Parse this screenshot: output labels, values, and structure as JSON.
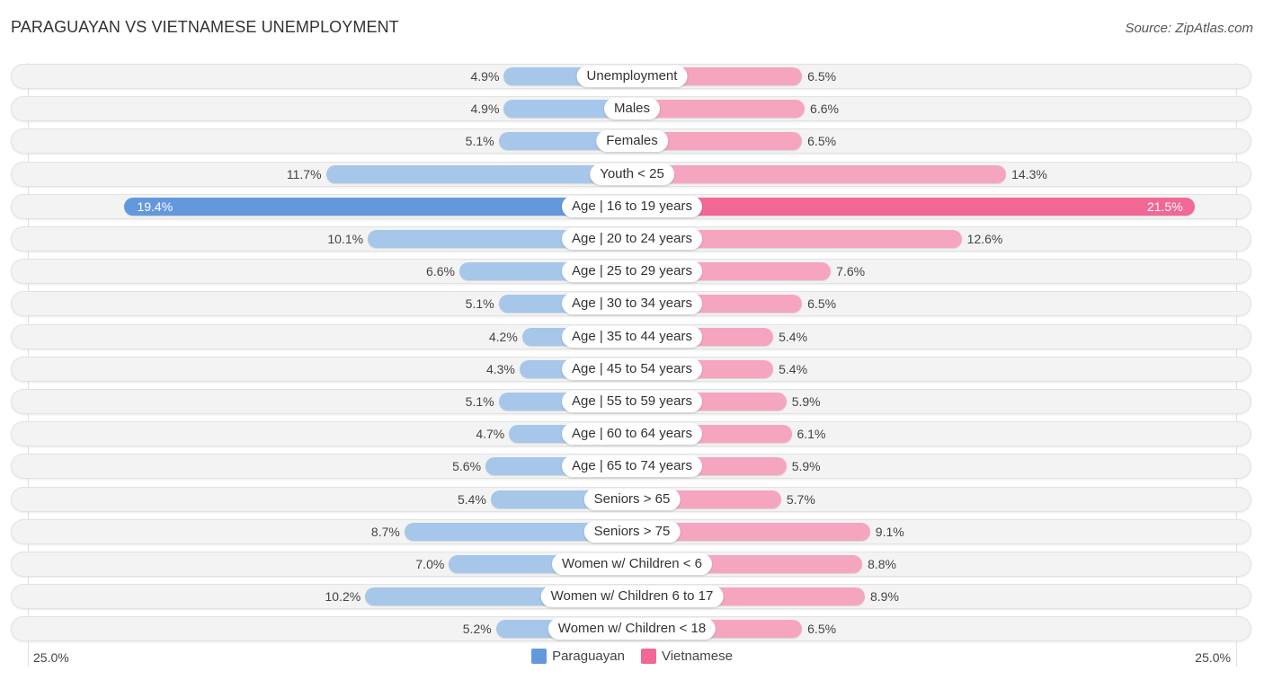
{
  "header": {
    "title": "PARAGUAYAN VS VIETNAMESE UNEMPLOYMENT",
    "source": "Source: ZipAtlas.com"
  },
  "colors": {
    "paraguayan": "#a7c7ea",
    "paraguayan_highlight": "#6399dc",
    "vietnamese": "#f6a5bf",
    "vietnamese_highlight": "#f06893"
  },
  "chart_data": {
    "type": "bar",
    "orientation": "horizontal-diverging",
    "title": "PARAGUAYAN VS VIETNAMESE UNEMPLOYMENT",
    "xlabel": "",
    "ylabel": "",
    "xlim": [
      -25,
      25
    ],
    "axis_labels": {
      "left": "25.0%",
      "right": "25.0%"
    },
    "legend": {
      "position": "bottom-center",
      "entries": [
        "Paraguayan",
        "Vietnamese"
      ]
    },
    "highlight_index": 4,
    "categories": [
      "Unemployment",
      "Males",
      "Females",
      "Youth < 25",
      "Age | 16 to 19 years",
      "Age | 20 to 24 years",
      "Age | 25 to 29 years",
      "Age | 30 to 34 years",
      "Age | 35 to 44 years",
      "Age | 45 to 54 years",
      "Age | 55 to 59 years",
      "Age | 60 to 64 years",
      "Age | 65 to 74 years",
      "Seniors > 65",
      "Seniors > 75",
      "Women w/ Children < 6",
      "Women w/ Children 6 to 17",
      "Women w/ Children < 18"
    ],
    "series": [
      {
        "name": "Paraguayan",
        "values": [
          4.9,
          4.9,
          5.1,
          11.7,
          19.4,
          10.1,
          6.6,
          5.1,
          4.2,
          4.3,
          5.1,
          4.7,
          5.6,
          5.4,
          8.7,
          7.0,
          10.2,
          5.2
        ],
        "labels": [
          "4.9%",
          "4.9%",
          "5.1%",
          "11.7%",
          "19.4%",
          "10.1%",
          "6.6%",
          "5.1%",
          "4.2%",
          "4.3%",
          "5.1%",
          "4.7%",
          "5.6%",
          "5.4%",
          "8.7%",
          "7.0%",
          "10.2%",
          "5.2%"
        ]
      },
      {
        "name": "Vietnamese",
        "values": [
          6.5,
          6.6,
          6.5,
          14.3,
          21.5,
          12.6,
          7.6,
          6.5,
          5.4,
          5.4,
          5.9,
          6.1,
          5.9,
          5.7,
          9.1,
          8.8,
          8.9,
          6.5
        ],
        "labels": [
          "6.5%",
          "6.6%",
          "6.5%",
          "14.3%",
          "21.5%",
          "12.6%",
          "7.6%",
          "6.5%",
          "5.4%",
          "5.4%",
          "5.9%",
          "6.1%",
          "5.9%",
          "5.7%",
          "9.1%",
          "8.8%",
          "8.9%",
          "6.5%"
        ]
      }
    ]
  }
}
